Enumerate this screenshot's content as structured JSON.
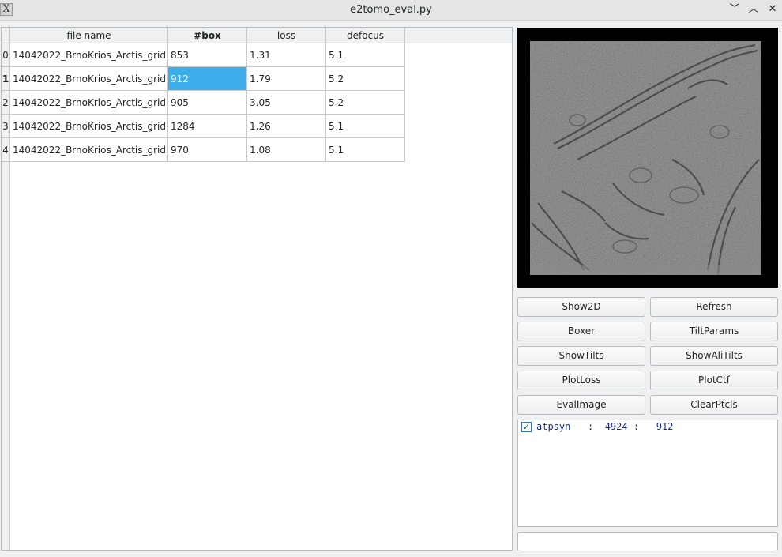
{
  "window": {
    "title": "e2tomo_eval.py",
    "icon_glyph": "X",
    "minimize_glyph": "﹀",
    "maximize_glyph": "︿",
    "close_glyph": "✕"
  },
  "table": {
    "headers": [
      "file name",
      "#box",
      "loss",
      "defocus"
    ],
    "rows": [
      {
        "index": "0",
        "file_name": "14042022_BrnoKrios_Arctis_grid...",
        "box": "853",
        "loss": "1.31",
        "defocus": "5.1"
      },
      {
        "index": "1",
        "file_name": "14042022_BrnoKrios_Arctis_grid...",
        "box": "912",
        "loss": "1.79",
        "defocus": "5.2"
      },
      {
        "index": "2",
        "file_name": "14042022_BrnoKrios_Arctis_grid...",
        "box": "905",
        "loss": "3.05",
        "defocus": "5.2"
      },
      {
        "index": "3",
        "file_name": "14042022_BrnoKrios_Arctis_grid...",
        "box": "1284",
        "loss": "1.26",
        "defocus": "5.1"
      },
      {
        "index": "4",
        "file_name": "14042022_BrnoKrios_Arctis_grid...",
        "box": "970",
        "loss": "1.08",
        "defocus": "5.1"
      }
    ]
  },
  "buttons": {
    "show2d": "Show2D",
    "refresh": "Refresh",
    "boxer": "Boxer",
    "tiltparams": "TiltParams",
    "showtilts": "ShowTilts",
    "showalitilts": "ShowAliTilts",
    "plotloss": "PlotLoss",
    "plotctf": "PlotCtf",
    "evalimage": "EvalImage",
    "clearptcls": "ClearPtcls"
  },
  "particle_list": {
    "items": [
      {
        "checked": true,
        "check_glyph": "✓",
        "label": "atpsyn   :  4924 :   912"
      }
    ]
  },
  "colors": {
    "selection": "#3daee9",
    "list_text": "#1a2f86"
  }
}
